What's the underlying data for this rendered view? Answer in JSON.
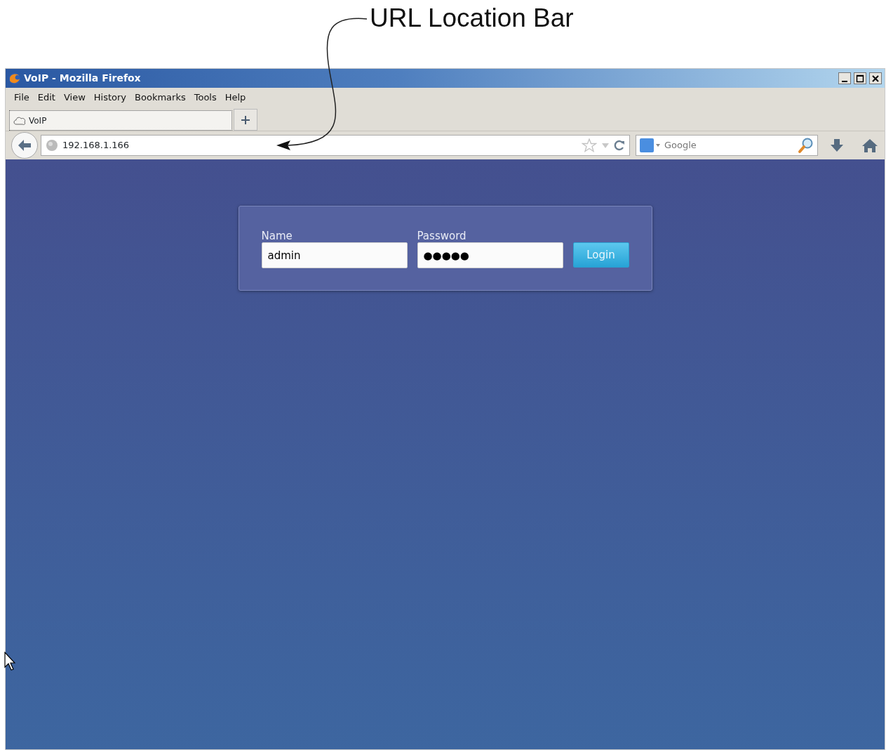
{
  "annotation": {
    "label": "URL Location Bar"
  },
  "window": {
    "title": "VoIP - Mozilla Firefox"
  },
  "menu": [
    "File",
    "Edit",
    "View",
    "History",
    "Bookmarks",
    "Tools",
    "Help"
  ],
  "tabs": [
    {
      "label": "VoIP",
      "selected": true
    }
  ],
  "address_bar": {
    "url": "192.168.1.166"
  },
  "search": {
    "placeholder": "Google"
  },
  "login": {
    "fields": [
      {
        "label": "Name",
        "value": "admin"
      },
      {
        "label": "Password",
        "value": "●●●●●"
      }
    ],
    "button": "Login"
  }
}
